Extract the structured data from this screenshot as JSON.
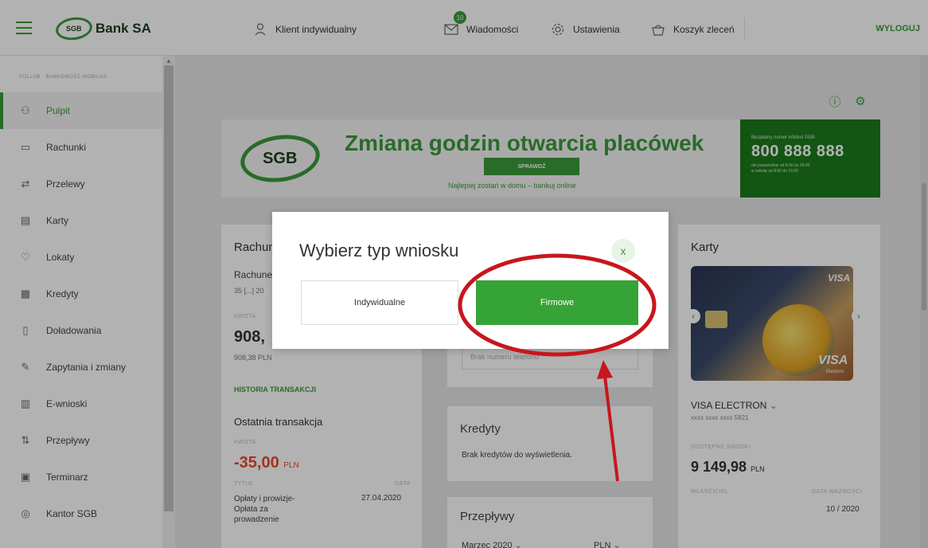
{
  "header": {
    "brand": "Bank SA",
    "logo_text": "SGB",
    "client_label": "Klient indywidualny",
    "messages_label": "Wiadomości",
    "messages_badge": "10",
    "settings_label": "Ustawienia",
    "cart_label": "Koszyk zleceń",
    "logout_label": "WYLOGUJ"
  },
  "sidebar": {
    "top_text": "POLLUB · BANKOWOŚĆ MOBILNA",
    "items": [
      {
        "label": "Pulpit",
        "icon": "dashboard-icon",
        "active": true
      },
      {
        "label": "Rachunki",
        "icon": "accounts-icon"
      },
      {
        "label": "Przelewy",
        "icon": "transfer-icon"
      },
      {
        "label": "Karty",
        "icon": "card-icon"
      },
      {
        "label": "Lokaty",
        "icon": "deposit-icon"
      },
      {
        "label": "Kredyty",
        "icon": "credit-icon"
      },
      {
        "label": "Doładowania",
        "icon": "phone-topup-icon"
      },
      {
        "label": "Zapytania i zmiany",
        "icon": "edit-icon"
      },
      {
        "label": "E-wnioski",
        "icon": "application-icon"
      },
      {
        "label": "Przepływy",
        "icon": "flows-icon"
      },
      {
        "label": "Terminarz",
        "icon": "calendar-icon"
      },
      {
        "label": "Kantor SGB",
        "icon": "exchange-icon"
      }
    ]
  },
  "banner": {
    "logo_text": "SGB",
    "title": "Zmiana godzin otwarcia placówek",
    "button": "SPRAWDŹ",
    "subtitle": "Najlepiej zostań w domu – bankuj online",
    "hotline_label": "Bezpłatny numer infolinii SGB:",
    "hotline": "800 888 888",
    "hotline_note1": "dni powszednie od 8:00 do 20:00",
    "hotline_note2": "w sobotę od 8:00 do 15:00"
  },
  "accounts": {
    "title": "Rachunki",
    "account_name": "Rachunek",
    "account_number": "35 [...] 20",
    "amount_label": "KWOTA",
    "amount": "908,",
    "amount_full": "908,38 PLN",
    "history_link": "HISTORIA TRANSAKCJI",
    "last_tx": "Ostatnia transakcja",
    "tx_amount_label": "KWOTA",
    "tx_amount": "-35,00",
    "tx_currency": "PLN",
    "title_label": "TYTUŁ",
    "date_label": "DATA",
    "tx_title_1": "Opłaty i prowizje-",
    "tx_title_2": "Opłata za",
    "tx_title_3": "prowadzenie",
    "tx_date": "27.04.2020"
  },
  "mid": {
    "placeholder": "Brak numeru telefonu"
  },
  "credits": {
    "title": "Kredyty",
    "empty": "Brak kredytów do wyświetlenia."
  },
  "flows": {
    "title": "Przepływy",
    "month": "Marzec 2020",
    "currency": "PLN"
  },
  "cards": {
    "title": "Karty",
    "card_name": "VISA ELECTRON",
    "card_number": "xxxx xxxx xxxx 5821",
    "available_label": "DOSTĘPNE ŚRODKI",
    "available": "9 149,98",
    "currency": "PLN",
    "owner_label": "WŁAŚCICIEL",
    "expiry_label": "DATA WAŻNOŚCI",
    "expiry": "10 / 2020",
    "visa": "VISA",
    "electron": "Electron"
  },
  "modal": {
    "title": "Wybierz typ wniosku",
    "close": "x",
    "option_individual": "Indywidualne",
    "option_business": "Firmowe"
  }
}
